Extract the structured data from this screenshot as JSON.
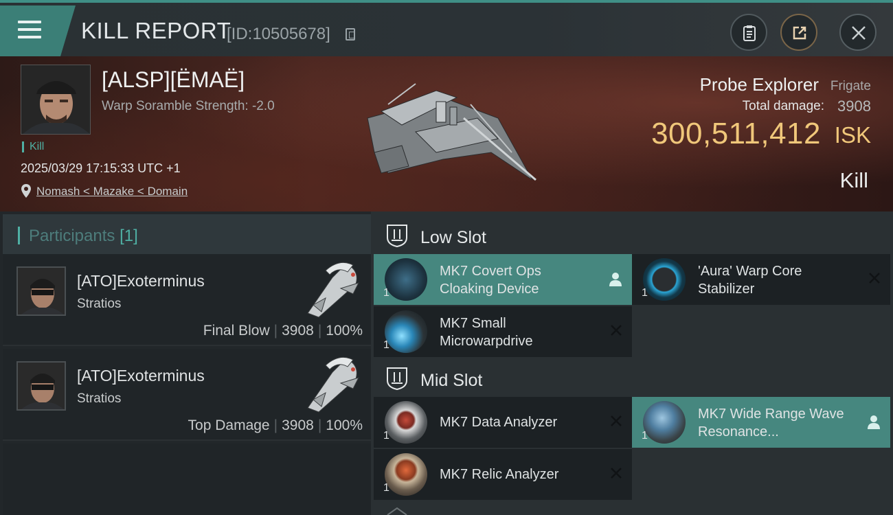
{
  "header": {
    "title": "KILL REPORT",
    "report_id": "[ID:10505678]",
    "accent_color": "#3f8f86"
  },
  "victim": {
    "name": "[ALSP][ËMAË]",
    "warp_scramble": "Warp Soramble Strength: -2.0",
    "tag": "Kill",
    "timestamp": "2025/03/29 17:15:33 UTC +1",
    "location": "Nomash < Mazake < Domain",
    "ship_name": "Probe Explorer",
    "ship_class": "Frigate",
    "damage_label": "Total damage:",
    "damage_value": "3908",
    "isk_value": "300,511,412",
    "isk_unit": "ISK",
    "result": "Kill"
  },
  "participants": {
    "title": "Participants",
    "count": "[1]",
    "rows": [
      {
        "name": "[ATO]Exoterminus",
        "ship": "Stratios",
        "label": "Final Blow",
        "damage": "3908",
        "percent": "100%"
      },
      {
        "name": "[ATO]Exoterminus",
        "ship": "Stratios",
        "label": "Top Damage",
        "damage": "3908",
        "percent": "100%"
      }
    ]
  },
  "fitting": {
    "low_slot": {
      "title": "Low Slot",
      "modules": [
        {
          "name": "MK7 Covert Ops Cloaking Device",
          "qty": "1",
          "status": "dropped"
        },
        {
          "name": "'Aura' Warp Core Stabilizer",
          "qty": "1",
          "status": "destroyed"
        },
        {
          "name": "MK7 Small Microwarpdrive",
          "qty": "1",
          "status": "destroyed"
        }
      ]
    },
    "mid_slot": {
      "title": "Mid Slot",
      "modules": [
        {
          "name": "MK7 Data Analyzer",
          "qty": "1",
          "status": "destroyed"
        },
        {
          "name": "MK7 Wide Range Wave Resonance...",
          "qty": "1",
          "status": "dropped"
        },
        {
          "name": "MK7 Relic Analyzer",
          "qty": "1",
          "status": "destroyed"
        }
      ]
    }
  }
}
